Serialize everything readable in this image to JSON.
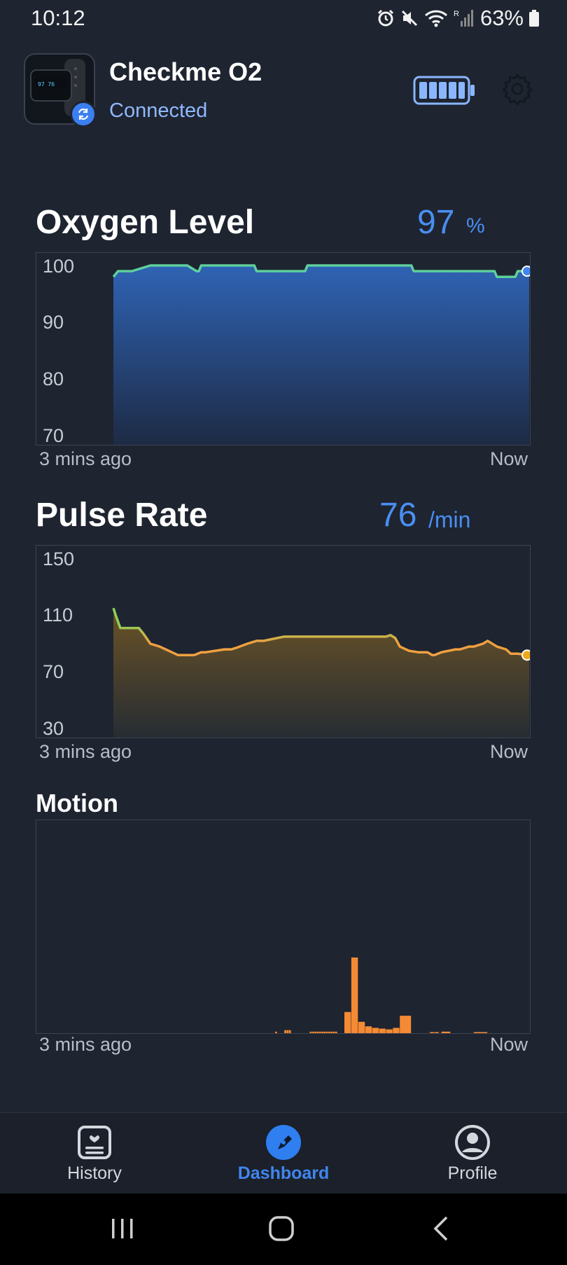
{
  "status_bar": {
    "time": "10:12",
    "battery_percent": "63%",
    "icons": [
      "alarm-icon",
      "mute-icon",
      "wifi-icon",
      "signal-icon",
      "battery-icon"
    ]
  },
  "device": {
    "name": "Checkme O2",
    "status": "Connected",
    "battery_level": 1.0,
    "icons": [
      "device-image",
      "sync-icon",
      "battery-icon",
      "gear-icon"
    ]
  },
  "oxygen": {
    "title": "Oxygen Level",
    "value": "97",
    "unit": "%",
    "y_ticks": [
      "100",
      "90",
      "80",
      "70"
    ],
    "start_label": "3 mins ago",
    "end_label": "Now"
  },
  "pulse": {
    "title": "Pulse Rate",
    "value": "76",
    "unit": "/min",
    "y_ticks": [
      "150",
      "110",
      "70",
      "30"
    ],
    "start_label": "3 mins ago",
    "end_label": "Now"
  },
  "motion": {
    "title": "Motion",
    "start_label": "3 mins ago",
    "end_label": "Now"
  },
  "tabs": [
    {
      "label": "History",
      "icon": "history-icon",
      "active": false
    },
    {
      "label": "Dashboard",
      "icon": "dashboard-icon",
      "active": true
    },
    {
      "label": "Profile",
      "icon": "profile-icon",
      "active": false
    }
  ],
  "system_nav": [
    "recents-button",
    "home-button",
    "back-button"
  ],
  "colors": {
    "background": "#1e2430",
    "accent": "#4a8ef2",
    "oxygen_line": "#5ecf9c",
    "pulse_line_high": "#8ccf5a",
    "pulse_line_low": "#f0a040",
    "motion_bar": "#f58a33"
  },
  "chart_data": [
    {
      "type": "area",
      "name": "oxygen",
      "ylim": [
        70,
        100
      ],
      "x_range": [
        0,
        180
      ],
      "x": [
        0,
        2,
        3,
        8,
        16,
        17,
        32,
        36,
        37,
        38,
        61,
        62,
        83,
        84,
        129,
        130,
        165,
        166,
        174,
        175,
        180
      ],
      "y": [
        98,
        99,
        99,
        99,
        100,
        100,
        100,
        99,
        99,
        100,
        100,
        99,
        99,
        100,
        100,
        99,
        99,
        98,
        98,
        99,
        99
      ]
    },
    {
      "type": "area",
      "name": "pulse",
      "ylim": [
        30,
        150
      ],
      "x_range": [
        0,
        180
      ],
      "x": [
        0,
        1,
        3,
        11,
        13,
        16,
        20,
        28,
        35,
        38,
        40,
        48,
        51,
        53,
        58,
        62,
        65,
        68,
        74,
        76,
        80,
        95,
        100,
        110,
        118,
        120,
        122,
        124,
        128,
        132,
        136,
        138,
        139,
        142,
        148,
        150,
        154,
        156,
        160,
        162,
        166,
        170,
        172,
        175,
        180
      ],
      "y": [
        115,
        110,
        101,
        101,
        97,
        90,
        88,
        82,
        82,
        84,
        84,
        86,
        86,
        87,
        90,
        92,
        92,
        93,
        95,
        95,
        95,
        95,
        95,
        95,
        95,
        96,
        94,
        88,
        85,
        84,
        84,
        82,
        82,
        84,
        86,
        86,
        88,
        88,
        90,
        92,
        88,
        86,
        83,
        83,
        82
      ]
    },
    {
      "type": "bar",
      "name": "motion",
      "ylim": [
        0,
        100
      ],
      "x_range": [
        0,
        180
      ],
      "bars": [
        {
          "x": 70,
          "w": 1,
          "v": 2
        },
        {
          "x": 74,
          "w": 1,
          "v": 4
        },
        {
          "x": 75,
          "w": 1,
          "v": 4
        },
        {
          "x": 76,
          "w": 1,
          "v": 4
        },
        {
          "x": 85,
          "w": 1,
          "v": 2
        },
        {
          "x": 86,
          "w": 1,
          "v": 2
        },
        {
          "x": 87,
          "w": 1,
          "v": 2
        },
        {
          "x": 88,
          "w": 1,
          "v": 2
        },
        {
          "x": 89,
          "w": 1,
          "v": 2
        },
        {
          "x": 90,
          "w": 1,
          "v": 2
        },
        {
          "x": 91,
          "w": 1,
          "v": 2
        },
        {
          "x": 92,
          "w": 1,
          "v": 2
        },
        {
          "x": 93,
          "w": 1,
          "v": 2
        },
        {
          "x": 94,
          "w": 1,
          "v": 2
        },
        {
          "x": 95,
          "w": 1,
          "v": 2
        },
        {
          "x": 96,
          "w": 1,
          "v": 2
        },
        {
          "x": 100,
          "w": 3,
          "v": 28
        },
        {
          "x": 103,
          "w": 3,
          "v": 100
        },
        {
          "x": 106,
          "w": 3,
          "v": 15
        },
        {
          "x": 109,
          "w": 3,
          "v": 9
        },
        {
          "x": 112,
          "w": 3,
          "v": 7
        },
        {
          "x": 115,
          "w": 3,
          "v": 6
        },
        {
          "x": 118,
          "w": 3,
          "v": 5
        },
        {
          "x": 121,
          "w": 3,
          "v": 7
        },
        {
          "x": 124,
          "w": 5,
          "v": 23
        },
        {
          "x": 137,
          "w": 2,
          "v": 1
        },
        {
          "x": 139,
          "w": 2,
          "v": 1
        },
        {
          "x": 142,
          "w": 4,
          "v": 2
        },
        {
          "x": 156,
          "w": 6,
          "v": 1
        }
      ]
    }
  ]
}
